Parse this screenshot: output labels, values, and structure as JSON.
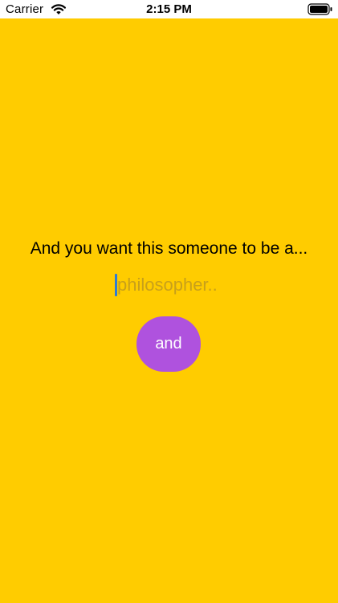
{
  "status_bar": {
    "carrier": "Carrier",
    "time": "2:15 PM",
    "wifi_icon": "wifi-icon",
    "battery_icon": "battery-icon"
  },
  "main": {
    "prompt": "And you want this someone to be a...",
    "input": {
      "value": "",
      "placeholder": "philosopher.."
    },
    "next_button_label": "and"
  },
  "colors": {
    "background": "#FFCC00",
    "status_bar_background": "#FFFFFF",
    "button_fill": "#AF52DE",
    "button_text": "#FFFFFF",
    "placeholder_text": "#C8A01A",
    "cursor": "#2E7BD6"
  }
}
